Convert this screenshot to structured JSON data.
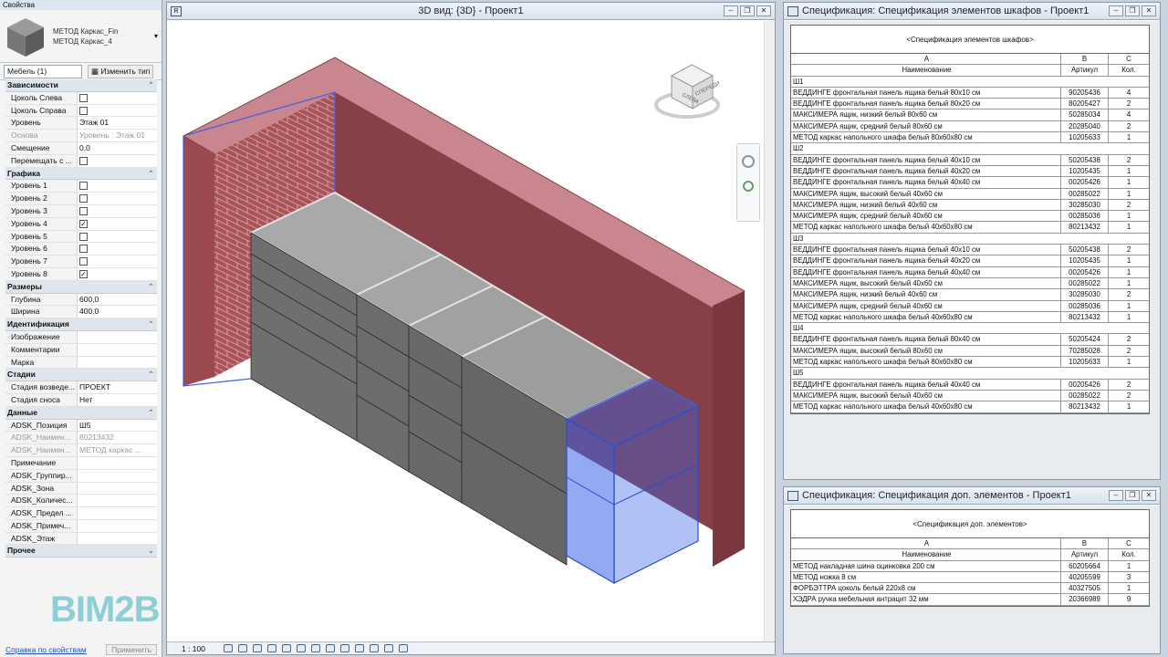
{
  "properties": {
    "title": "Свойства",
    "type_line1": "МЕТОД Каркас_Fin",
    "type_line2": "МЕТОД Каркас_4",
    "category": "Мебель (1)",
    "edit_type": "Изменить тип",
    "groups": [
      {
        "label": "Зависимости",
        "rows": [
          {
            "k": "Цоколь Слева",
            "cb": false
          },
          {
            "k": "Цоколь Справа",
            "cb": false
          },
          {
            "k": "Уровень",
            "v": "Этаж 01"
          },
          {
            "k": "Основа",
            "v": "Уровень : Этаж 01",
            "dis": true
          },
          {
            "k": "Смещение",
            "v": "0,0"
          },
          {
            "k": "Перемещать с ...",
            "cb": false
          }
        ]
      },
      {
        "label": "Графика",
        "rows": [
          {
            "k": "Уровень 1",
            "cb": false
          },
          {
            "k": "Уровень 2",
            "cb": false
          },
          {
            "k": "Уровень 3",
            "cb": false
          },
          {
            "k": "Уровень 4",
            "cb": true
          },
          {
            "k": "Уровень 5",
            "cb": false
          },
          {
            "k": "Уровень 6",
            "cb": false
          },
          {
            "k": "Уровень 7",
            "cb": false
          },
          {
            "k": "Уровень 8",
            "cb": true
          }
        ]
      },
      {
        "label": "Размеры",
        "rows": [
          {
            "k": "Глубина",
            "v": "600,0"
          },
          {
            "k": "Ширина",
            "v": "400,0"
          }
        ]
      },
      {
        "label": "Идентификация",
        "rows": [
          {
            "k": "Изображение",
            "v": ""
          },
          {
            "k": "Комментарии",
            "v": ""
          },
          {
            "k": "Марка",
            "v": ""
          }
        ]
      },
      {
        "label": "Стадии",
        "rows": [
          {
            "k": "Стадия возведе...",
            "v": "ПРОЕКТ"
          },
          {
            "k": "Стадия сноса",
            "v": "Нет"
          }
        ]
      },
      {
        "label": "Данные",
        "rows": [
          {
            "k": "ADSK_Позиция",
            "v": "Ш5"
          },
          {
            "k": "ADSK_Наимен...",
            "v": "80213432",
            "dis": true
          },
          {
            "k": "ADSK_Наимен...",
            "v": "МЕТОД каркас ...",
            "dis": true
          },
          {
            "k": "Примечание",
            "v": ""
          },
          {
            "k": "ADSK_Группир...",
            "v": ""
          },
          {
            "k": "ADSK_Зона",
            "v": ""
          },
          {
            "k": "ADSK_Количес...",
            "v": ""
          },
          {
            "k": "ADSK_Предел ...",
            "v": ""
          },
          {
            "k": "ADSK_Примеч...",
            "v": ""
          },
          {
            "k": "ADSK_Этаж",
            "v": ""
          }
        ]
      },
      {
        "label": "Прочее",
        "rows": []
      }
    ],
    "help_link": "Справка по свойствам",
    "apply": "Применить"
  },
  "watermark": "BIM2B",
  "view3d": {
    "title": "3D вид: {3D} - Проект1",
    "scale": "1 : 100",
    "viewcube": {
      "left": "СЛЕВА",
      "front": "СПЕРЕДИ"
    },
    "colors": {
      "brick": "#a84f55",
      "brick_top": "#c98a92",
      "cabinet": "#6f6f6f",
      "selected": "#3a63e6"
    }
  },
  "schedule1": {
    "title": "Спецификация: Спецификация элементов шкафов - Проект1",
    "caption": "<Спецификация элементов шкафов>",
    "letters": [
      "A",
      "B",
      "C"
    ],
    "headers": [
      "Наименование",
      "Артикул",
      "Кол."
    ],
    "groups": [
      {
        "name": "Ш1",
        "rows": [
          [
            "ВЕДДИНГЕ фронтальная панель ящика белый 80x10 см",
            "90205436",
            "4"
          ],
          [
            "ВЕДДИНГЕ фронтальная панель ящика белый 80x20 см",
            "80205427",
            "2"
          ],
          [
            "МАКСИМЕРА ящик, низкий белый 80x60 см",
            "50285034",
            "4"
          ],
          [
            "МАКСИМЕРА ящик, средний белый 80x60 см",
            "20285040",
            "2"
          ],
          [
            "МЕТОД каркас напольного шкафа белый 80x60x80 см",
            "10205633",
            "1"
          ]
        ]
      },
      {
        "name": "Ш2",
        "rows": [
          [
            "ВЕДДИНГЕ фронтальная панель ящика белый 40x10 см",
            "50205438",
            "2"
          ],
          [
            "ВЕДДИНГЕ фронтальная панель ящика белый 40x20 см",
            "10205435",
            "1"
          ],
          [
            "ВЕДДИНГЕ фронтальная панель ящика белый 40x40 см",
            "00205426",
            "1"
          ],
          [
            "МАКСИМЕРА ящик, высокий белый 40x60 см",
            "00285022",
            "1"
          ],
          [
            "МАКСИМЕРА ящик, низкий белый 40x60 см",
            "30285030",
            "2"
          ],
          [
            "МАКСИМЕРА ящик, средний белый 40x60 см",
            "00285036",
            "1"
          ],
          [
            "МЕТОД каркас напольного шкафа белый 40x60x80 см",
            "80213432",
            "1"
          ]
        ]
      },
      {
        "name": "Ш3",
        "rows": [
          [
            "ВЕДДИНГЕ фронтальная панель ящика белый 40x10 см",
            "50205438",
            "2"
          ],
          [
            "ВЕДДИНГЕ фронтальная панель ящика белый 40x20 см",
            "10205435",
            "1"
          ],
          [
            "ВЕДДИНГЕ фронтальная панель ящика белый 40x40 см",
            "00205426",
            "1"
          ],
          [
            "МАКСИМЕРА ящик, высокий белый 40x60 см",
            "00285022",
            "1"
          ],
          [
            "МАКСИМЕРА ящик, низкий белый 40x60 см",
            "30285030",
            "2"
          ],
          [
            "МАКСИМЕРА ящик, средний белый 40x60 см",
            "00285036",
            "1"
          ],
          [
            "МЕТОД каркас напольного шкафа белый 40x60x80 см",
            "80213432",
            "1"
          ]
        ]
      },
      {
        "name": "Ш4",
        "rows": [
          [
            "ВЕДДИНГЕ фронтальная панель ящика белый 80x40 см",
            "50205424",
            "2"
          ],
          [
            "МАКСИМЕРА ящик, высокий белый 80x60 см",
            "70285028",
            "2"
          ],
          [
            "МЕТОД каркас напольного шкафа белый 80x60x80 см",
            "10205633",
            "1"
          ]
        ]
      },
      {
        "name": "Ш5",
        "rows": [
          [
            "ВЕДДИНГЕ фронтальная панель ящика белый 40x40 см",
            "00205426",
            "2"
          ],
          [
            "МАКСИМЕРА ящик, высокий белый 40x60 см",
            "00285022",
            "2"
          ],
          [
            "МЕТОД каркас напольного шкафа белый 40x60x80 см",
            "80213432",
            "1"
          ]
        ]
      }
    ]
  },
  "schedule2": {
    "title": "Спецификация: Спецификация доп. элементов - Проект1",
    "caption": "<Спецификация доп. элементов>",
    "letters": [
      "A",
      "B",
      "C"
    ],
    "headers": [
      "Наименование",
      "Артикул",
      "Кол."
    ],
    "rows": [
      [
        "МЕТОД накладная шина оцинковка 200 см",
        "60205664",
        "1"
      ],
      [
        "МЕТОД ножка 8 см",
        "40205599",
        "3"
      ],
      [
        "ФОРБЭТТРА цоколь белый 220x8 см",
        "40327505",
        "1"
      ],
      [
        "ХЭДРА ручка мебельная антрацит 32 мм",
        "20366989",
        "9"
      ]
    ]
  }
}
